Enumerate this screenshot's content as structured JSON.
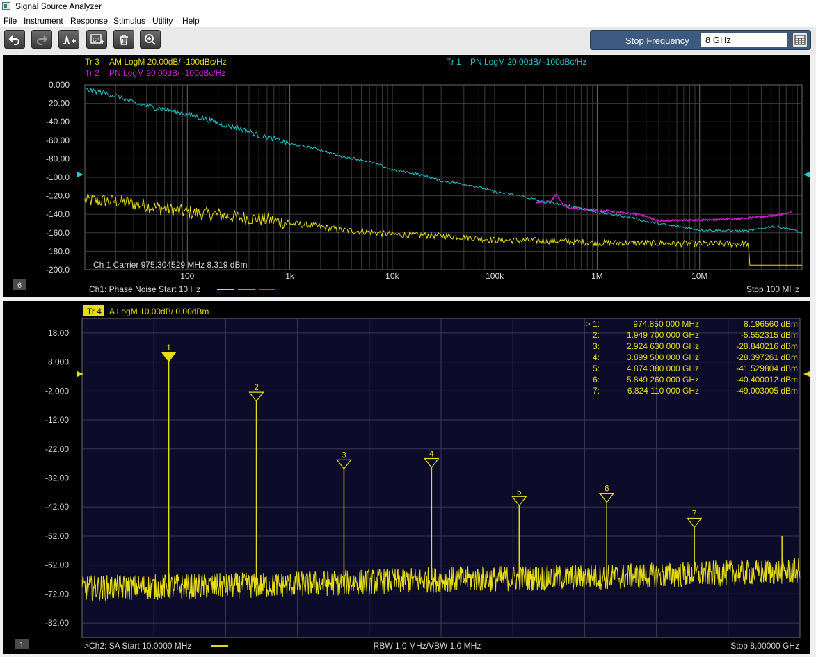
{
  "app": {
    "title": "Signal Source Analyzer"
  },
  "menu": {
    "items": [
      "File",
      "Instrument",
      "Response",
      "Stimulus",
      "Utility",
      "Help"
    ]
  },
  "toolbar": {
    "buttons": [
      "undo-icon",
      "redo-icon",
      "marker-add-icon",
      "channel-add-icon",
      "delete-icon",
      "zoom-icon"
    ],
    "stop_frequency_label": "Stop Frequency",
    "stop_frequency_value": "8 GHz"
  },
  "colors": {
    "trace_am": "#e6dc12",
    "trace_pn1": "#1fc8d2",
    "trace_pn2": "#d21ed2",
    "grid": "#4a4a4a",
    "sa_background": "#0c0c2a",
    "panel_text": "#d8d8d8",
    "toolbar_panel": "#3c5a80"
  },
  "phase_noise_window": {
    "window_number": "6",
    "traces": [
      {
        "id": "tr3",
        "label": "Tr 3",
        "text": "AM LogM 20.00dB/  -100dBc/Hz",
        "color": "#e6dc12"
      },
      {
        "id": "tr2",
        "label": "Tr 2",
        "text": "PN LogM 20.00dB/  -100dBc/Hz",
        "color": "#d21ed2"
      },
      {
        "id": "tr1",
        "label": "Tr 1",
        "text": "PN LogM 20.00dB/  -100dBc/Hz",
        "color": "#1fc8d2"
      }
    ],
    "carrier_text": "Ch 1  Carrier 975.304529 MHz   8.319 dBm",
    "footer_left": "Ch1: Phase Noise  Start   10 Hz",
    "footer_right": "Stop  100 MHz",
    "reference_level": -100
  },
  "spectrum_window": {
    "window_number": "1",
    "trace_label": "Tr 4",
    "trace_text": "A LogM 10.00dB/  0.00dBm",
    "footer_left": ">Ch2: SA  Start   10.0000 MHz",
    "footer_center": "RBW  1.0 MHz/VBW  1.0 MHz",
    "footer_right": "Stop  8.00000 GHz",
    "reference_level": -2,
    "markers": [
      {
        "label": "1",
        "prefix": "> 1:",
        "freq": "974.850 000  MHz",
        "value": "8.196560 dBm"
      },
      {
        "label": "2",
        "prefix": "2:",
        "freq": "1.949 700 000 GHz",
        "value": "-5.552315 dBm"
      },
      {
        "label": "3",
        "prefix": "3:",
        "freq": "2.924 630 000 GHz",
        "value": "-28.840216 dBm"
      },
      {
        "label": "4",
        "prefix": "4:",
        "freq": "3.899 500 000 GHz",
        "value": "-28.397261 dBm"
      },
      {
        "label": "5",
        "prefix": "5:",
        "freq": "4.874 380 000 GHz",
        "value": "-41.529804 dBm"
      },
      {
        "label": "6",
        "prefix": "6:",
        "freq": "5.849 260 000 GHz",
        "value": "-40.400012 dBm"
      },
      {
        "label": "7",
        "prefix": "7:",
        "freq": "6.824 110 000 GHz",
        "value": "-49.003005 dBm"
      }
    ]
  },
  "chart_data": [
    {
      "type": "line",
      "x_scale": "log",
      "xlim": [
        10,
        100000000
      ],
      "ylim": [
        -200,
        0
      ],
      "x_tick_labels": [
        "100",
        "1k",
        "10k",
        "100k",
        "1M",
        "10M"
      ],
      "y_tick_labels": [
        "0.000",
        "-20.00",
        "-40.00",
        "-60.00",
        "-80.00",
        "-100.0",
        "-120.0",
        "-140.0",
        "-160.0",
        "-180.0",
        "-200.0"
      ],
      "grid": true,
      "series": [
        {
          "name": "Tr 1",
          "color": "#1fc8d2",
          "x": [
            10,
            20,
            30,
            50,
            100,
            200,
            500,
            1000,
            3000,
            10000,
            30000,
            100000,
            300000,
            1000000,
            3000000,
            5000000,
            10000000,
            20000000,
            30000000,
            50000000,
            70000000,
            100000000
          ],
          "y": [
            -5,
            -12,
            -20,
            -25,
            -32,
            -42,
            -55,
            -64,
            -77,
            -92,
            -104,
            -116,
            -127,
            -138,
            -148,
            -152,
            -157,
            -158,
            -158,
            -153,
            -155,
            -160
          ]
        },
        {
          "name": "Tr 2",
          "color": "#d21ed2",
          "x": [
            250000,
            350000,
            400000,
            450000,
            520000,
            800000,
            1700000,
            2600000,
            3800000,
            80000000
          ],
          "y": [
            -127,
            -126,
            -118,
            -128,
            -133,
            -135,
            -138,
            -140,
            -147,
            -138
          ]
        },
        {
          "name": "Tr 3",
          "color": "#e6dc12",
          "x": [
            10,
            20,
            50,
            100,
            300,
            1000,
            3000,
            10000,
            100000,
            1000000,
            10000000,
            30000000,
            30500000,
            100000000
          ],
          "y": [
            -125,
            -126,
            -133,
            -138,
            -143,
            -150,
            -157,
            -162,
            -168,
            -171,
            -172,
            -172,
            -195,
            -195
          ]
        }
      ]
    },
    {
      "type": "line",
      "xlim": [
        0.01,
        8
      ],
      "x_unit": "GHz",
      "ylim": [
        -87,
        23
      ],
      "y_tick_labels": [
        "18.00",
        "8.000",
        "-2.000",
        "-12.00",
        "-22.00",
        "-32.00",
        "-42.00",
        "-52.00",
        "-62.00",
        "-72.00",
        "-82.00"
      ],
      "noise_floor": {
        "x": [
          0.01,
          2,
          4,
          6,
          8
        ],
        "y": [
          -70,
          -69,
          -67,
          -66,
          -64
        ]
      },
      "peaks": [
        {
          "x": 0.97485,
          "y": 8.19656
        },
        {
          "x": 1.9497,
          "y": -5.552315
        },
        {
          "x": 2.92463,
          "y": -28.840216
        },
        {
          "x": 3.8995,
          "y": -28.397261
        },
        {
          "x": 4.87438,
          "y": -41.529804
        },
        {
          "x": 5.84926,
          "y": -40.400012
        },
        {
          "x": 6.82411,
          "y": -49.003005
        },
        {
          "x": 7.8,
          "y": -52
        }
      ]
    }
  ]
}
